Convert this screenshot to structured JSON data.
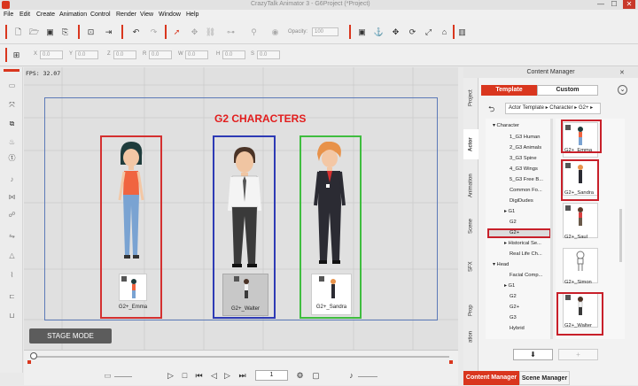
{
  "window": {
    "title": "CrazyTalk Animator 3 - G6Project (*Project)",
    "min": "—",
    "max": "☐",
    "close": "✕"
  },
  "menu": [
    "File",
    "Edit",
    "Create",
    "Animation",
    "Control",
    "Render",
    "View",
    "Window",
    "Help"
  ],
  "toolbar": {
    "opacity_label": "Opacity:",
    "opacity_value": "100"
  },
  "transform": {
    "fields": [
      {
        "label": "X",
        "value": "0.0"
      },
      {
        "label": "Y",
        "value": "0.0"
      },
      {
        "label": "Z",
        "value": "0.0"
      },
      {
        "label": "R",
        "value": "0.0"
      },
      {
        "label": "W",
        "value": "0.0"
      },
      {
        "label": "H",
        "value": "0.0"
      },
      {
        "label": "S",
        "value": "0.0"
      }
    ]
  },
  "viewport": {
    "fps": "FPS: 32.07",
    "heading": "G2 CHARACTERS",
    "stage_mode": "STAGE MODE",
    "characters": [
      {
        "name": "G2+_Emma",
        "box_color": "#d43030"
      },
      {
        "name": "G2+_Walter",
        "box_color": "#2d3ab5"
      },
      {
        "name": "G2+_Sandra",
        "box_color": "#3fbd3f"
      }
    ]
  },
  "timeline": {
    "frame": "1"
  },
  "content_manager": {
    "title": "Content Manager",
    "side_tabs": [
      "Project",
      "Actor",
      "Animation",
      "Scene",
      "SFX",
      "Prop",
      "ation"
    ],
    "active_side_tab": "Actor",
    "tabs": {
      "template": "Template",
      "custom": "Custom"
    },
    "breadcrumb": "Actor Template ▸ Character ▸ G2+ ▸",
    "tree": [
      {
        "label": "▾ Character",
        "indent": 0
      },
      {
        "label": "1_G3 Human",
        "indent": 2
      },
      {
        "label": "2_G3 Animals",
        "indent": 2
      },
      {
        "label": "3_G3 Spine",
        "indent": 2
      },
      {
        "label": "4_G3 Wings",
        "indent": 2
      },
      {
        "label": "5_G3 Free B...",
        "indent": 2
      },
      {
        "label": "Common Fo...",
        "indent": 2
      },
      {
        "label": "DigiDudes",
        "indent": 2
      },
      {
        "label": "▸ G1",
        "indent": 1
      },
      {
        "label": "G2",
        "indent": 2
      },
      {
        "label": "G2+",
        "indent": 2
      },
      {
        "label": "▸ Historical Se...",
        "indent": 1
      },
      {
        "label": "Real Life Ch...",
        "indent": 2
      },
      {
        "label": "▾ Head",
        "indent": 0
      },
      {
        "label": "Facial Comp...",
        "indent": 2
      },
      {
        "label": "▸ G1",
        "indent": 1
      },
      {
        "label": "G2",
        "indent": 2
      },
      {
        "label": "G2+",
        "indent": 2
      },
      {
        "label": "G3",
        "indent": 2
      },
      {
        "label": "Hybrid",
        "indent": 2
      }
    ],
    "selected_tree_item": "G2+",
    "items": [
      {
        "name": "G2+_Emma",
        "highlight": true
      },
      {
        "name": "G2+_Sandra",
        "highlight": true
      },
      {
        "name": "G2+_Saul",
        "highlight": false
      },
      {
        "name": "G2+_Simon",
        "highlight": false
      },
      {
        "name": "G2+_Walter",
        "highlight": true
      }
    ],
    "bottom_tabs": {
      "content": "Content Manager",
      "scene": "Scene Manager"
    }
  },
  "colors": {
    "accent": "#d9361e",
    "heading": "#e21d1d",
    "highlight": "#c8202a"
  }
}
